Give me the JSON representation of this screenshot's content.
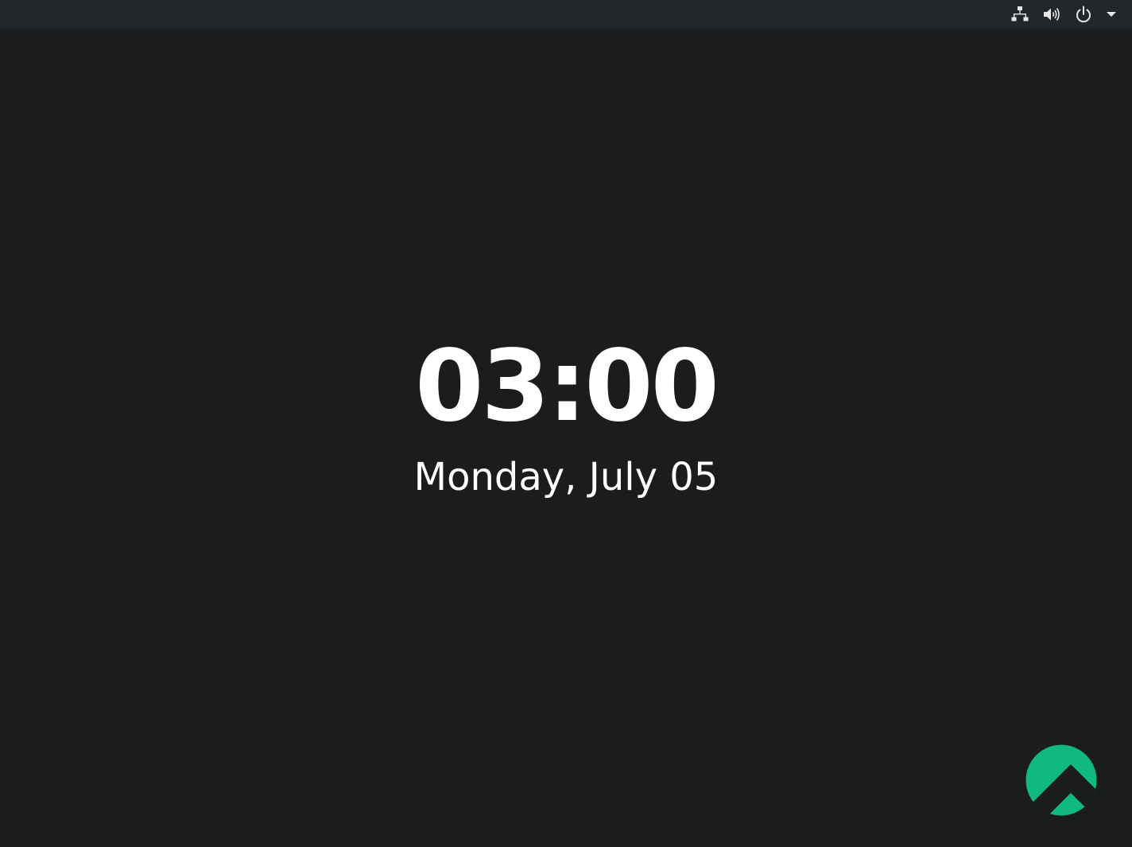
{
  "lockscreen": {
    "time": "03:00",
    "date": "Monday, July 05"
  },
  "topbar": {
    "status_icons": [
      "network-wired-icon",
      "volume-icon",
      "power-icon",
      "chevron-down-icon"
    ]
  },
  "branding": {
    "logo_icon": "rocky-linux-logo",
    "accent_color": "#10b981"
  },
  "colors": {
    "background": "#1b1c1e",
    "topbar": "#24272a",
    "text": "#ffffff",
    "icon": "#e6e6e6"
  }
}
